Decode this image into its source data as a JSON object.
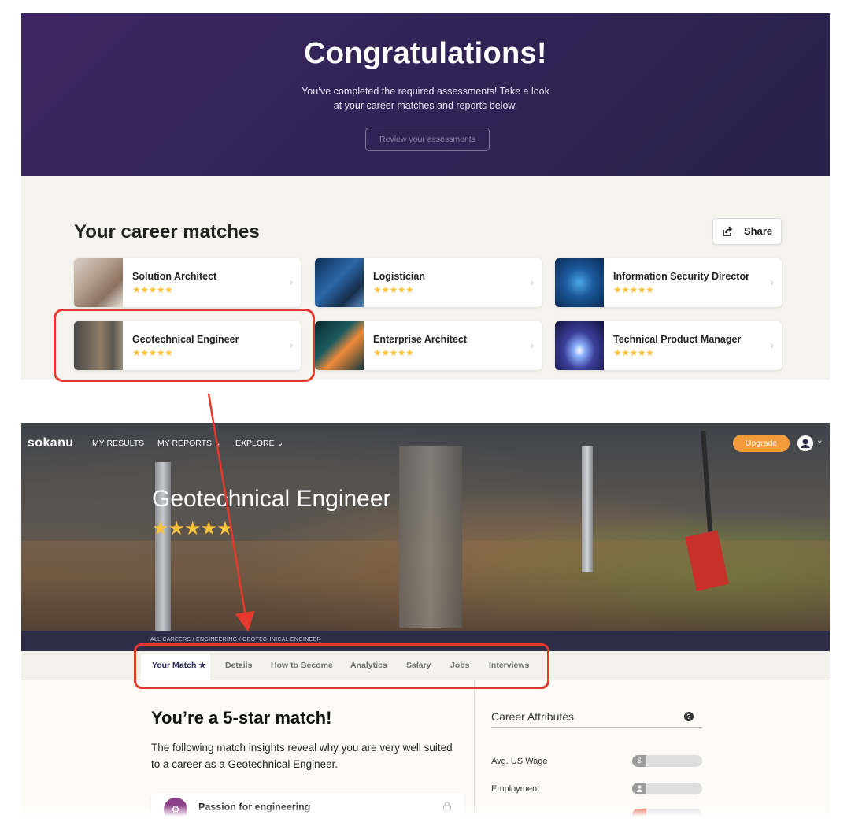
{
  "top": {
    "title": "Congratulations!",
    "subtitle_line1": "You’ve completed the required assessments! Take a look",
    "subtitle_line2": "at your career matches and reports below.",
    "review_button": "Review your assessments",
    "matches_title": "Your career matches",
    "share_label": "Share",
    "cards": [
      {
        "name": "Solution Architect",
        "stars": "★★★★★",
        "rating": 5,
        "thumb": "solution-architect-thumbnail"
      },
      {
        "name": "Logistician",
        "stars": "★★★★★",
        "rating": 5,
        "thumb": "logistician-thumbnail"
      },
      {
        "name": "Information Security Director",
        "stars": "★★★★★",
        "rating": 5,
        "thumb": "information-security-director-thumbnail"
      },
      {
        "name": "Geotechnical Engineer",
        "stars": "★★★★★",
        "rating": 5,
        "thumb": "geotechnical-engineer-thumbnail"
      },
      {
        "name": "Enterprise Architect",
        "stars": "★★★★★",
        "rating": 5,
        "thumb": "enterprise-architect-thumbnail"
      },
      {
        "name": "Technical Product Manager",
        "stars": "★★★★★",
        "rating": 5,
        "thumb": "technical-product-manager-thumbnail"
      }
    ],
    "chevron": "›"
  },
  "bottom": {
    "logo": "sokanu",
    "nav": [
      "MY RESULTS",
      "MY REPORTS ⌄",
      "EXPLORE ⌄"
    ],
    "upgrade": "Upgrade",
    "avatar_chevron": "⌄",
    "career_title": "Geotechnical Engineer",
    "career_stars": "★★★★★",
    "career_rating": 4.5,
    "breadcrumb": "ALL CAREERS   /   ENGINEERING   /   GEOTECHNICAL ENGINEER",
    "tabs": [
      "Your Match ★",
      "Details",
      "How to Become",
      "Analytics",
      "Salary",
      "Jobs",
      "Interviews"
    ],
    "match_title": "You’re a 5-star match!",
    "match_desc": "The following match insights reveal why you are very well suited to a career as a Geotechnical Engineer.",
    "insight_label": "Passion for engineering",
    "attributes_title": "Career Attributes",
    "attributes": [
      {
        "label": "Avg. US Wage",
        "badge": "$"
      },
      {
        "label": "Employment",
        "badge": "👤"
      }
    ]
  },
  "colors": {
    "accent_purple": "#2f2454",
    "star_yellow": "#f7c43c",
    "upgrade_orange": "#f39b3a",
    "highlight_red": "#e6382d"
  }
}
